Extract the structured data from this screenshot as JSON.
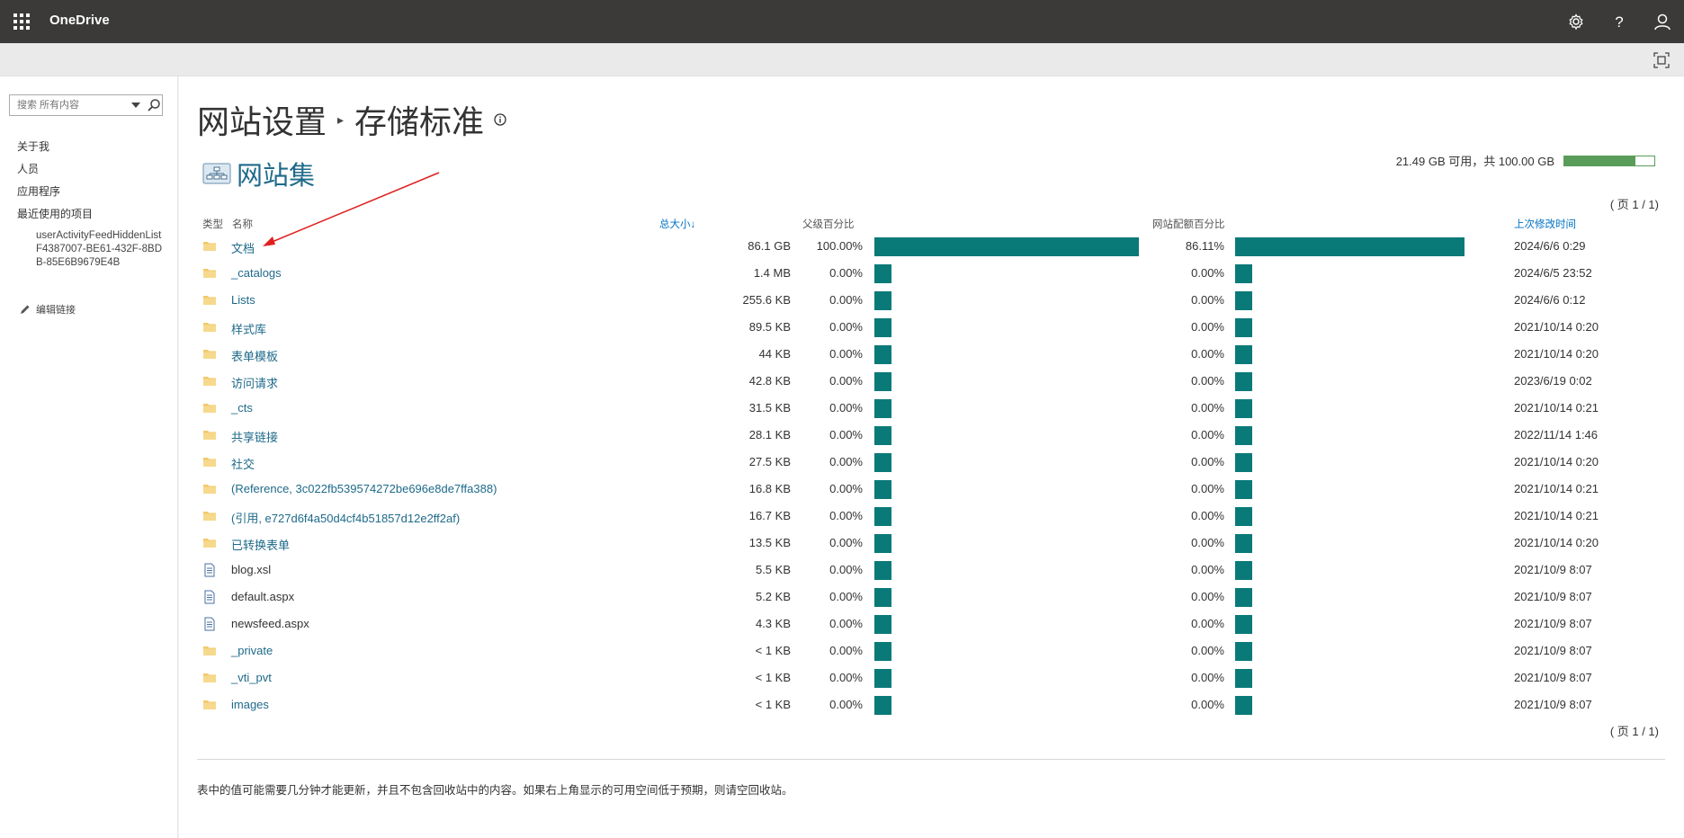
{
  "topbar": {
    "app_name": "OneDrive"
  },
  "search": {
    "placeholder": "搜索 所有内容"
  },
  "nav": {
    "items": [
      "关于我",
      "人员",
      "应用程序",
      "最近使用的项目"
    ],
    "recent": "userActivityFeedHiddenListF4387007-BE61-432F-8BDB-85E6B9679E4B",
    "edit_links": "编辑链接"
  },
  "page": {
    "breadcrumb_parent": "网站设置",
    "breadcrumb_current": "存储标准",
    "site_collection": "网站集",
    "quota_text": "21.49 GB 可用，共 100.00 GB",
    "quota_used_fraction": 0.785,
    "pager_top": "( 页 1 / 1)",
    "pager_bottom": "( 页 1 / 1)",
    "footnote": "表中的值可能需要几分钟才能更新，并且不包含回收站中的内容。如果右上角显示的可用空间低于预期，则请空回收站。"
  },
  "table": {
    "headers": {
      "type": "类型",
      "name": "名称",
      "size": "总大小",
      "parent_pct": "父级百分比",
      "quota_pct": "网站配额百分比",
      "modified": "上次修改时间"
    },
    "rows": [
      {
        "type": "folder",
        "name": "文档",
        "size": "86.1 GB",
        "parent_pct": "100.00%",
        "parent_frac": 1.0,
        "quota_pct": "86.11%",
        "quota_frac": 0.8611,
        "modified": "2024/6/6 0:29"
      },
      {
        "type": "folder",
        "name": "_catalogs",
        "size": "1.4 MB",
        "parent_pct": "0.00%",
        "parent_frac": 0,
        "quota_pct": "0.00%",
        "quota_frac": 0,
        "modified": "2024/6/5 23:52"
      },
      {
        "type": "folder",
        "name": "Lists",
        "size": "255.6 KB",
        "parent_pct": "0.00%",
        "parent_frac": 0,
        "quota_pct": "0.00%",
        "quota_frac": 0,
        "modified": "2024/6/6 0:12"
      },
      {
        "type": "folder",
        "name": "样式库",
        "size": "89.5 KB",
        "parent_pct": "0.00%",
        "parent_frac": 0,
        "quota_pct": "0.00%",
        "quota_frac": 0,
        "modified": "2021/10/14 0:20"
      },
      {
        "type": "folder",
        "name": "表单模板",
        "size": "44 KB",
        "parent_pct": "0.00%",
        "parent_frac": 0,
        "quota_pct": "0.00%",
        "quota_frac": 0,
        "modified": "2021/10/14 0:20"
      },
      {
        "type": "folder",
        "name": "访问请求",
        "size": "42.8 KB",
        "parent_pct": "0.00%",
        "parent_frac": 0,
        "quota_pct": "0.00%",
        "quota_frac": 0,
        "modified": "2023/6/19 0:02"
      },
      {
        "type": "folder",
        "name": "_cts",
        "size": "31.5 KB",
        "parent_pct": "0.00%",
        "parent_frac": 0,
        "quota_pct": "0.00%",
        "quota_frac": 0,
        "modified": "2021/10/14 0:21"
      },
      {
        "type": "folder",
        "name": "共享链接",
        "size": "28.1 KB",
        "parent_pct": "0.00%",
        "parent_frac": 0,
        "quota_pct": "0.00%",
        "quota_frac": 0,
        "modified": "2022/11/14 1:46"
      },
      {
        "type": "folder",
        "name": "社交",
        "size": "27.5 KB",
        "parent_pct": "0.00%",
        "parent_frac": 0,
        "quota_pct": "0.00%",
        "quota_frac": 0,
        "modified": "2021/10/14 0:20"
      },
      {
        "type": "folder",
        "name": "(Reference, 3c022fb539574272be696e8de7ffa388)",
        "size": "16.8 KB",
        "parent_pct": "0.00%",
        "parent_frac": 0,
        "quota_pct": "0.00%",
        "quota_frac": 0,
        "modified": "2021/10/14 0:21"
      },
      {
        "type": "folder",
        "name": "(引用, e727d6f4a50d4cf4b51857d12e2ff2af)",
        "size": "16.7 KB",
        "parent_pct": "0.00%",
        "parent_frac": 0,
        "quota_pct": "0.00%",
        "quota_frac": 0,
        "modified": "2021/10/14 0:21"
      },
      {
        "type": "folder",
        "name": "已转换表单",
        "size": "13.5 KB",
        "parent_pct": "0.00%",
        "parent_frac": 0,
        "quota_pct": "0.00%",
        "quota_frac": 0,
        "modified": "2021/10/14 0:20"
      },
      {
        "type": "file",
        "name": "blog.xsl",
        "size": "5.5 KB",
        "parent_pct": "0.00%",
        "parent_frac": 0,
        "quota_pct": "0.00%",
        "quota_frac": 0,
        "modified": "2021/10/9 8:07"
      },
      {
        "type": "file",
        "name": "default.aspx",
        "size": "5.2 KB",
        "parent_pct": "0.00%",
        "parent_frac": 0,
        "quota_pct": "0.00%",
        "quota_frac": 0,
        "modified": "2021/10/9 8:07"
      },
      {
        "type": "file",
        "name": "newsfeed.aspx",
        "size": "4.3 KB",
        "parent_pct": "0.00%",
        "parent_frac": 0,
        "quota_pct": "0.00%",
        "quota_frac": 0,
        "modified": "2021/10/9 8:07"
      },
      {
        "type": "folder",
        "name": "_private",
        "size": "< 1 KB",
        "parent_pct": "0.00%",
        "parent_frac": 0,
        "quota_pct": "0.00%",
        "quota_frac": 0,
        "modified": "2021/10/9 8:07"
      },
      {
        "type": "folder",
        "name": "_vti_pvt",
        "size": "< 1 KB",
        "parent_pct": "0.00%",
        "parent_frac": 0,
        "quota_pct": "0.00%",
        "quota_frac": 0,
        "modified": "2021/10/9 8:07"
      },
      {
        "type": "folder",
        "name": "images",
        "size": "< 1 KB",
        "parent_pct": "0.00%",
        "parent_frac": 0,
        "quota_pct": "0.00%",
        "quota_frac": 0,
        "modified": "2021/10/9 8:07"
      }
    ]
  },
  "colors": {
    "topbar": "#3b3a39",
    "bar": "#0a7a79",
    "link": "#1e6a8a",
    "quota": "#5a9c5a"
  }
}
